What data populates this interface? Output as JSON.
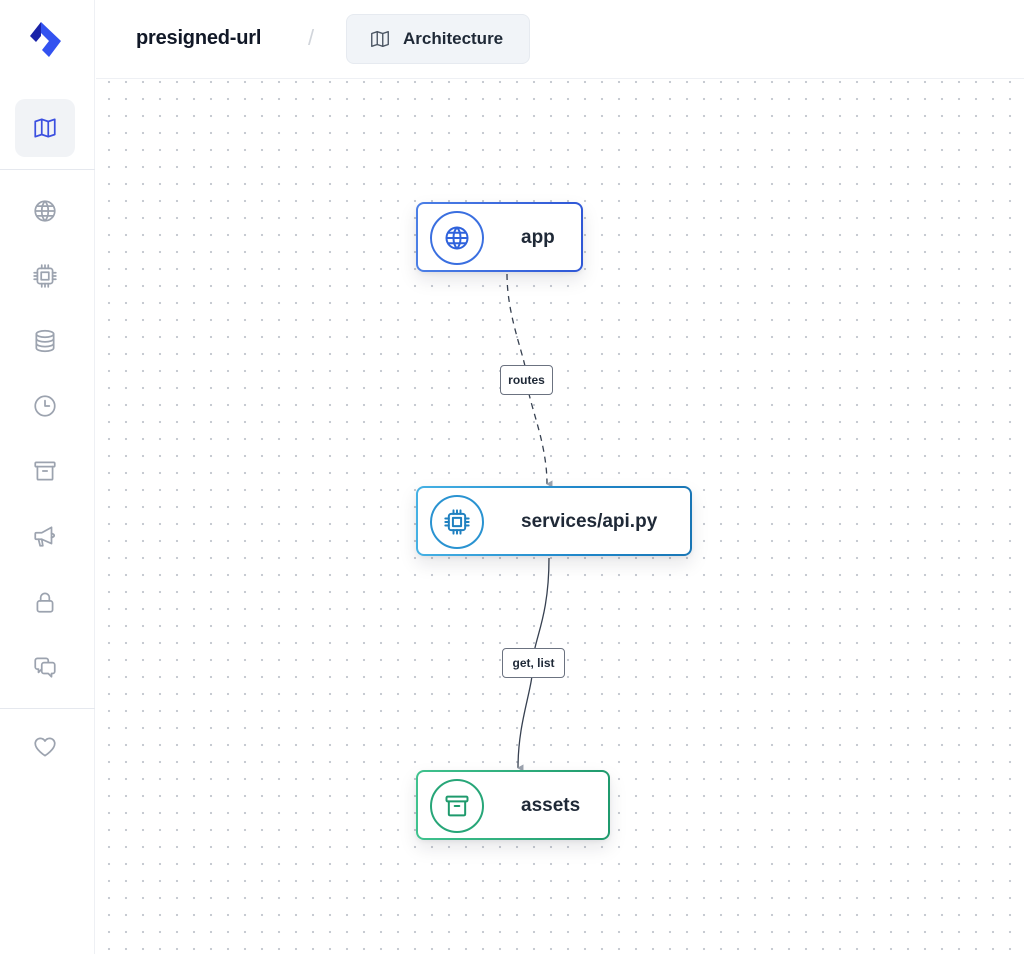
{
  "app": {
    "brand_color": "#3b4fe0"
  },
  "sidebar": {
    "items": [
      {
        "id": "architecture",
        "icon": "map-icon",
        "active": true
      },
      {
        "id": "globe",
        "icon": "globe-icon",
        "active": false
      },
      {
        "id": "services",
        "icon": "cpu-icon",
        "active": false
      },
      {
        "id": "databases",
        "icon": "database-icon",
        "active": false
      },
      {
        "id": "cron",
        "icon": "clock-icon",
        "active": false
      },
      {
        "id": "buckets",
        "icon": "archive-icon",
        "active": false
      },
      {
        "id": "pubsub",
        "icon": "megaphone-icon",
        "active": false
      },
      {
        "id": "secrets",
        "icon": "lock-icon",
        "active": false
      },
      {
        "id": "chat",
        "icon": "chat-icon",
        "active": false
      },
      {
        "id": "favorites",
        "icon": "heart-icon",
        "active": false
      }
    ]
  },
  "header": {
    "project_name": "presigned-url",
    "separator": "/",
    "current_tab": {
      "label": "Architecture",
      "icon": "map-icon"
    }
  },
  "diagram": {
    "nodes": [
      {
        "id": "app",
        "label": "app",
        "icon": "globe-icon",
        "color": "#2f62dc"
      },
      {
        "id": "services-api",
        "label": "services/api.py",
        "icon": "cpu-icon",
        "color": "#1f86c9"
      },
      {
        "id": "assets",
        "label": "assets",
        "icon": "archive-icon",
        "color": "#1f9a6d"
      }
    ],
    "edges": [
      {
        "from": "app",
        "to": "services-api",
        "label": "routes",
        "style": "dashed"
      },
      {
        "from": "services-api",
        "to": "assets",
        "label": "get, list",
        "style": "solid"
      }
    ]
  }
}
